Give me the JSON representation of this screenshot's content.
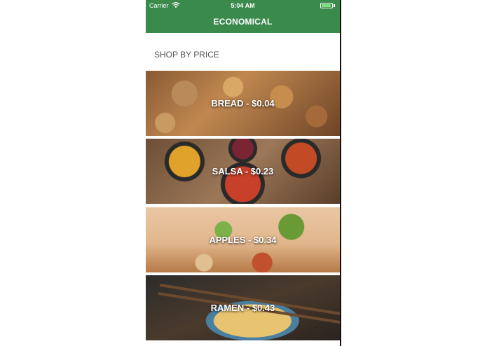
{
  "status_bar": {
    "carrier": "Carrier",
    "time": "5:04 AM",
    "icons": [
      "wifi-icon",
      "battery-icon"
    ]
  },
  "nav": {
    "title": "ECONOMICAL"
  },
  "section": {
    "title": "SHOP BY PRICE"
  },
  "items": [
    {
      "label": "BREAD - $0.04"
    },
    {
      "label": "SALSA - $0.23"
    },
    {
      "label": "APPLES - $0.34"
    },
    {
      "label": "RAMEN - $0.43"
    }
  ],
  "colors": {
    "nav_bar": "#3a8a4c",
    "text_light": "#ffffff",
    "section_text": "#555555"
  }
}
